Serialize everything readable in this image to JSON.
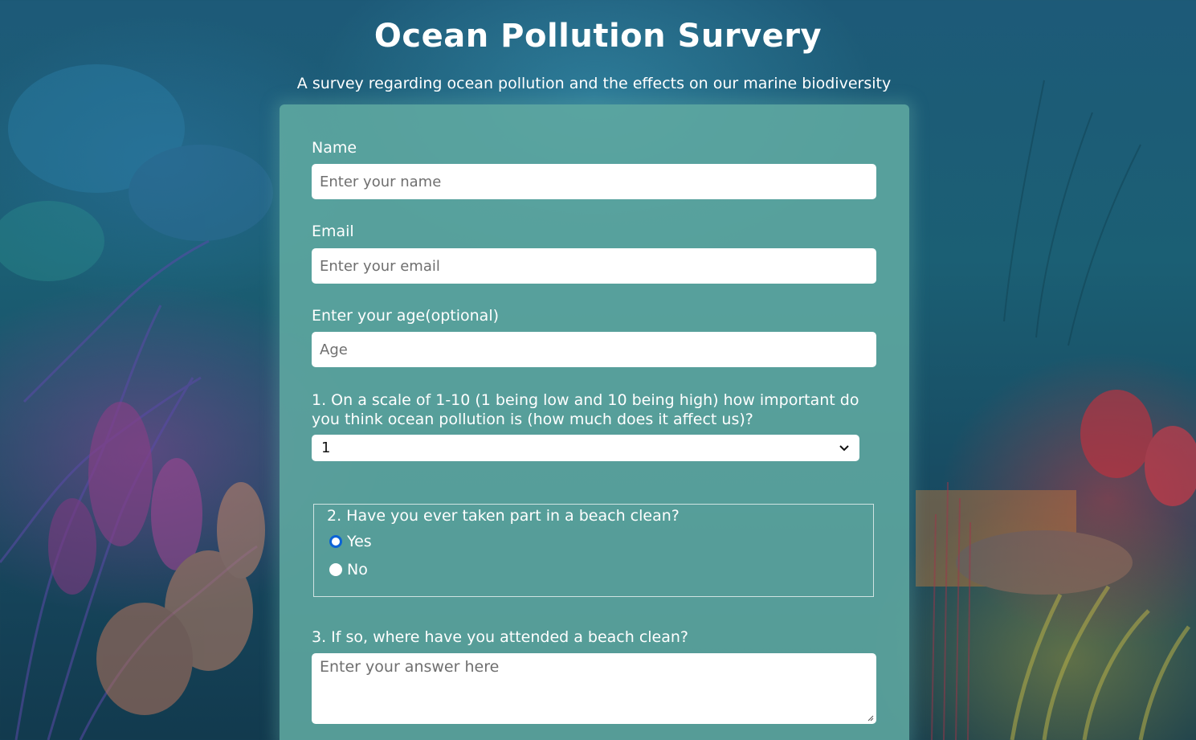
{
  "page": {
    "title": "Ocean Pollution Survery",
    "subtitle": "A survey regarding ocean pollution and the effects on our marine biodiversity"
  },
  "form": {
    "name": {
      "label": "Name",
      "placeholder": "Enter your name",
      "value": ""
    },
    "email": {
      "label": "Email",
      "placeholder": "Enter your email",
      "value": ""
    },
    "age": {
      "label": "Enter your age(optional)",
      "placeholder": "Age",
      "value": ""
    },
    "q1": {
      "label": "1. On a scale of 1-10 (1 being low and 10 being high) how important do you think ocean pollution is (how much does it affect us)?",
      "selected": "1",
      "icon": "chevron-down-icon"
    },
    "q2": {
      "legend": "2. Have you ever taken part in a beach clean?",
      "options": [
        {
          "label": "Yes",
          "checked": true
        },
        {
          "label": "No",
          "checked": false
        }
      ]
    },
    "q3": {
      "label": "3. If so, where have you attended a beach clean?",
      "placeholder": "Enter your answer here",
      "value": ""
    }
  },
  "colors": {
    "panel": "#60aaa2",
    "radio_accent": "#0b63d6",
    "background": "#1b5f74"
  }
}
